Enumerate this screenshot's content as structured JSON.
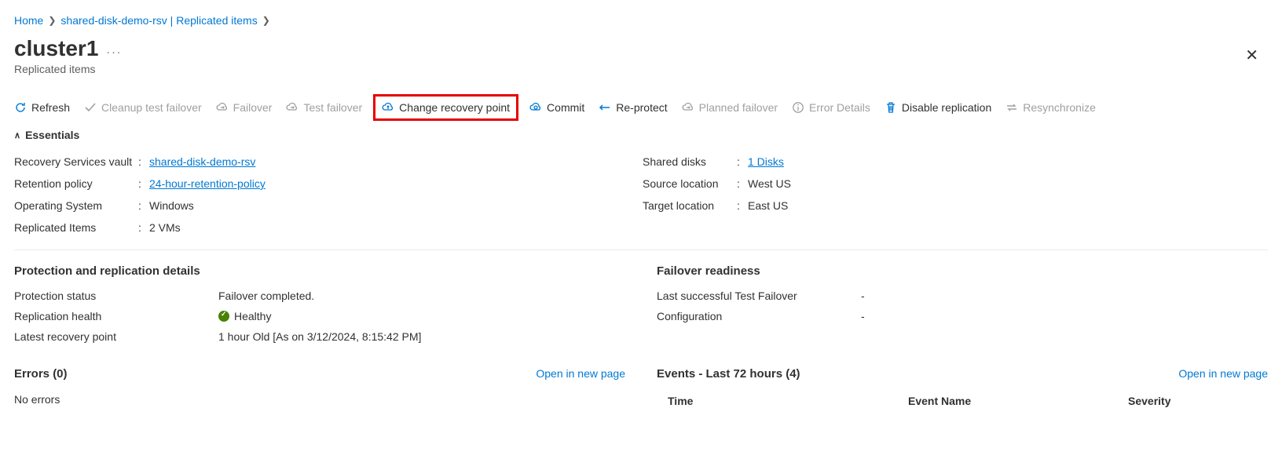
{
  "breadcrumb": {
    "home": "Home",
    "path": "shared-disk-demo-rsv | Replicated items"
  },
  "page": {
    "title": "cluster1",
    "subtitle": "Replicated items"
  },
  "toolbar": {
    "refresh": "Refresh",
    "cleanup": "Cleanup test failover",
    "failover": "Failover",
    "test_failover": "Test failover",
    "change_rp": "Change recovery point",
    "commit": "Commit",
    "reprotect": "Re-protect",
    "planned_failover": "Planned failover",
    "error_details": "Error Details",
    "disable_rep": "Disable replication",
    "resync": "Resynchronize"
  },
  "essentials_header": "Essentials",
  "essentials": {
    "left": {
      "rsv_label": "Recovery Services vault",
      "rsv_value": "shared-disk-demo-rsv",
      "ret_label": "Retention policy",
      "ret_value": "24-hour-retention-policy",
      "os_label": "Operating System",
      "os_value": "Windows",
      "rep_label": "Replicated Items",
      "rep_value": "2 VMs"
    },
    "right": {
      "sd_label": "Shared disks",
      "sd_value": "1 Disks",
      "src_label": "Source location",
      "src_value": "West US",
      "tgt_label": "Target location",
      "tgt_value": "East US"
    }
  },
  "protection": {
    "header": "Protection and replication details",
    "status_label": "Protection status",
    "status_value": "Failover completed.",
    "health_label": "Replication health",
    "health_value": "Healthy",
    "lrp_label": "Latest recovery point",
    "lrp_value": "1 hour Old [As on 3/12/2024, 8:15:42 PM]"
  },
  "readiness": {
    "header": "Failover readiness",
    "last_test_label": "Last successful Test Failover",
    "last_test_value": "-",
    "config_label": "Configuration",
    "config_value": "-"
  },
  "errors": {
    "header": "Errors (0)",
    "open_link": "Open in new page",
    "none": "No errors"
  },
  "events": {
    "header": "Events - Last 72 hours (4)",
    "open_link": "Open in new page",
    "col_time": "Time",
    "col_name": "Event Name",
    "col_sev": "Severity"
  }
}
